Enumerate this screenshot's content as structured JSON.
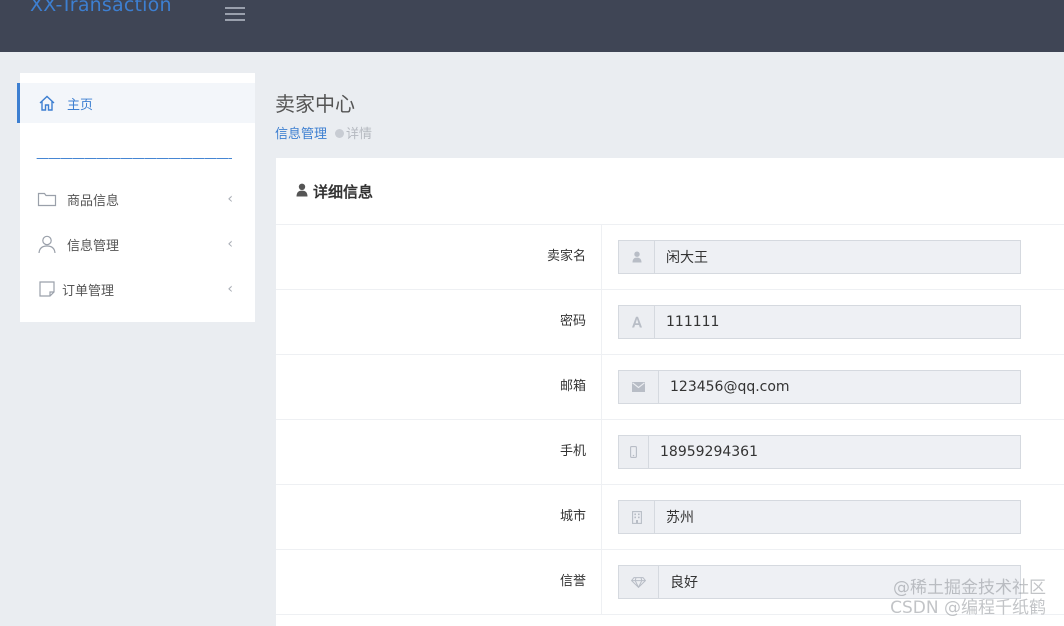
{
  "header": {
    "brand": "XX-Transaction"
  },
  "sidebar": {
    "items": [
      {
        "label": "主页",
        "icon": "home-icon"
      },
      {
        "label": "商品信息",
        "icon": "folder-icon"
      },
      {
        "label": "信息管理",
        "icon": "user-icon"
      },
      {
        "label": "订单管理",
        "icon": "note-icon"
      }
    ],
    "divider": "——————————————————",
    "chevron": "‹"
  },
  "page": {
    "title": "卖家中心",
    "breadcrumb": {
      "parent": "信息管理",
      "current": "详情"
    }
  },
  "panel": {
    "title": "详细信息",
    "fields": [
      {
        "label": "卖家名",
        "value": "闲大王",
        "icon": "user-icon"
      },
      {
        "label": "密码",
        "value": "111111",
        "icon": "font-icon"
      },
      {
        "label": "邮箱",
        "value": "123456@qq.com",
        "icon": "envelope-icon"
      },
      {
        "label": "手机",
        "value": "18959294361",
        "icon": "mobile-icon"
      },
      {
        "label": "城市",
        "value": "苏州",
        "icon": "building-icon"
      },
      {
        "label": "信誉",
        "value": "良好",
        "icon": "diamond-icon"
      }
    ]
  },
  "watermark": {
    "line1": "@稀土掘金技术社区",
    "line2": "CSDN @编程千纸鹤"
  },
  "colors": {
    "topbar": "#3f4555",
    "accent": "#3d7fd1",
    "background": "#eaedf1"
  }
}
